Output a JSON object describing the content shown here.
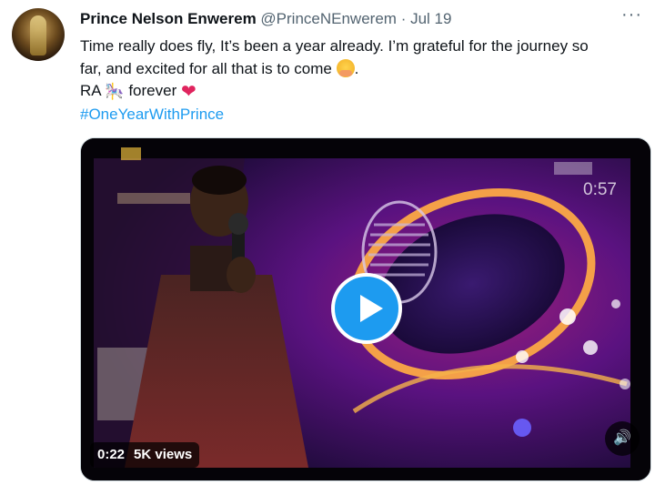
{
  "tweet": {
    "author_name": "Prince Nelson Enwerem",
    "handle": "@PrinceNEnwerem",
    "separator": "·",
    "date": "Jul 19",
    "more_icon": "more-horizontal-icon",
    "line1": "Time really does fly, It’s been a year already. I’m grateful for the journey so",
    "line2_text": "far, and excited for all that is to come",
    "line2_tail": ".",
    "emoji_hug": "hugging-face-emoji",
    "line3_prefix": "RA",
    "line3_carousel": "🎠",
    "line3_suffix": "forever",
    "heart": "❤",
    "hashtag": "#OneYearWithPrince"
  },
  "video": {
    "corner_time": "0:57",
    "elapsed": "0:22",
    "views": "5K views",
    "play_icon": "play-icon",
    "sound_icon": "speaker-icon",
    "sound_glyph": "🔊"
  },
  "colors": {
    "text": "#0f1419",
    "secondary": "#536471",
    "link": "#1d9bf0",
    "play_button": "#1d9bf0"
  }
}
